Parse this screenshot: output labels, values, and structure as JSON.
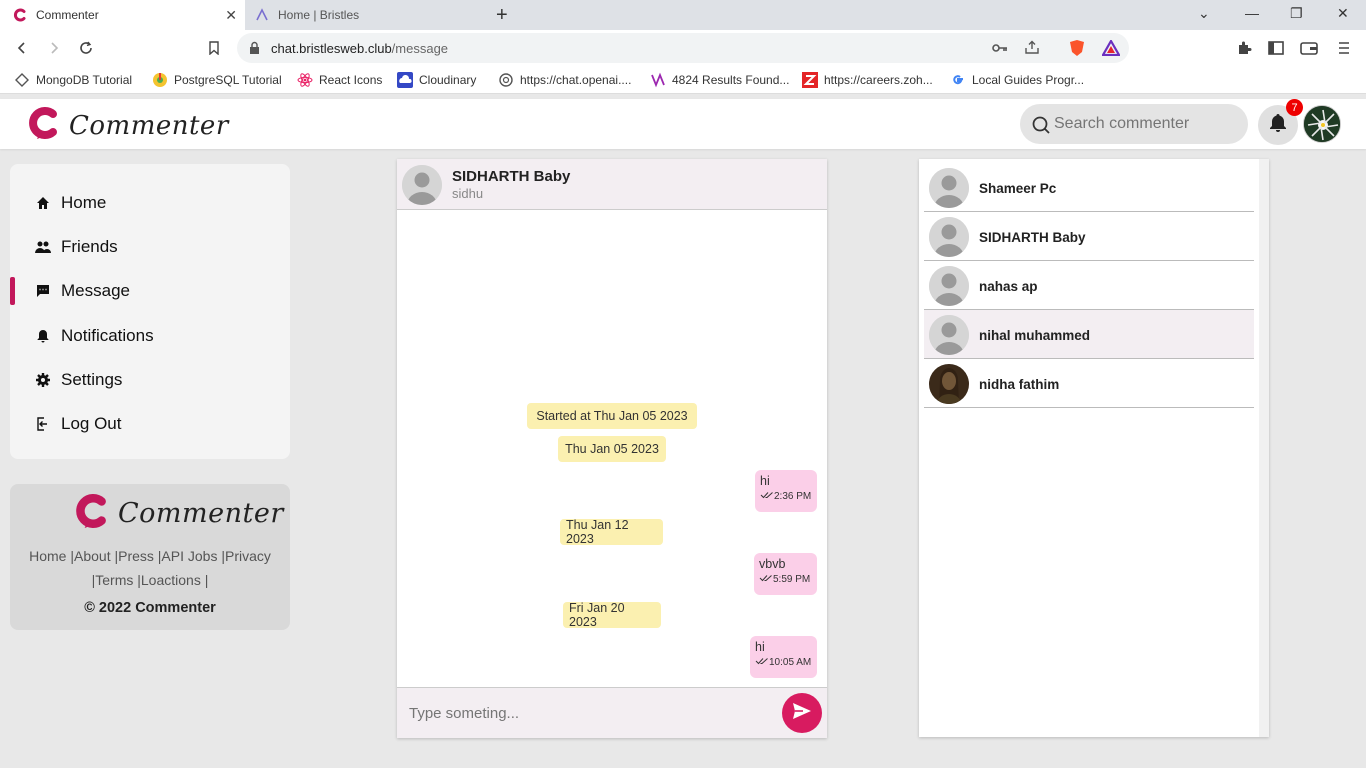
{
  "browser": {
    "tabs": [
      {
        "title": "Commenter"
      },
      {
        "title": "Home | Bristles"
      }
    ],
    "url": {
      "host": "chat.bristlesweb.club",
      "path": "/message"
    },
    "bookmarks": [
      {
        "label": "MongoDB Tutorial",
        "icon": "mongodb-icon"
      },
      {
        "label": "PostgreSQL Tutorial",
        "icon": "postgresql-icon"
      },
      {
        "label": "React Icons",
        "icon": "react-icon"
      },
      {
        "label": "Cloudinary",
        "icon": "cloudinary-icon"
      },
      {
        "label": "https://chat.openai....",
        "icon": "openai-icon"
      },
      {
        "label": "4824 Results Found...",
        "icon": "results-icon"
      },
      {
        "label": "https://careers.zoh...",
        "icon": "zoho-icon"
      },
      {
        "label": "Local Guides Progr...",
        "icon": "google-icon"
      }
    ]
  },
  "header": {
    "brand": "Commenter",
    "search_placeholder": "Search commenter",
    "notification_count": "7",
    "accent": "#c2185b"
  },
  "sidebar": {
    "items": [
      {
        "label": "Home",
        "icon": "home-icon"
      },
      {
        "label": "Friends",
        "icon": "friends-icon"
      },
      {
        "label": "Message",
        "icon": "message-icon",
        "active": true
      },
      {
        "label": "Notifications",
        "icon": "bell-icon"
      },
      {
        "label": "Settings",
        "icon": "gear-icon"
      },
      {
        "label": "Log Out",
        "icon": "logout-icon"
      }
    ]
  },
  "footer": {
    "brand": "Commenter",
    "links_line1": "Home |About |Press |API Jobs |Privacy",
    "links_line2": "|Terms |Loactions |",
    "copyright": "© 2022 Commenter"
  },
  "chat": {
    "name": "SIDHARTH Baby",
    "username": "sidhu",
    "started": "Started at Thu Jan 05 2023",
    "dates": [
      "Thu Jan 05 2023",
      "Thu Jan 12 2023",
      "Fri Jan 20 2023"
    ],
    "messages": [
      {
        "text": "hi",
        "time": "2:36 PM"
      },
      {
        "text": "vbvb",
        "time": "5:59 PM"
      },
      {
        "text": "hi",
        "time": "10:05 AM"
      }
    ],
    "input_placeholder": "Type someting..."
  },
  "contacts": [
    {
      "name": "Shameer Pc"
    },
    {
      "name": "SIDHARTH Baby"
    },
    {
      "name": "nahas ap"
    },
    {
      "name": "nihal muhammed"
    },
    {
      "name": "nidha fathim"
    }
  ]
}
